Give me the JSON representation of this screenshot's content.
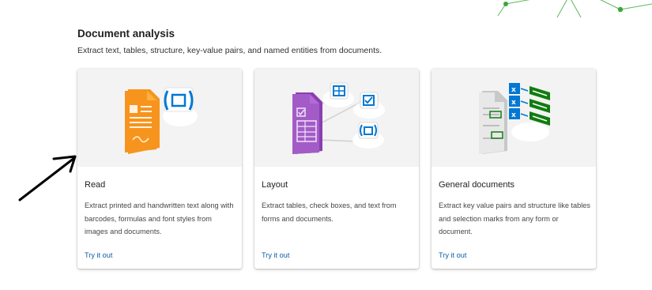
{
  "section": {
    "title": "Document analysis",
    "subtitle": "Extract text, tables, structure, key-value pairs, and named entities from documents."
  },
  "cards": [
    {
      "title": "Read",
      "description": "Extract printed and handwritten text along with barcodes, formulas and font styles from images and documents.",
      "link": "Try it out",
      "icon": "read-document-icon"
    },
    {
      "title": "Layout",
      "description": "Extract tables, check boxes, and text from forms and documents.",
      "link": "Try it out",
      "icon": "layout-document-icon"
    },
    {
      "title": "General documents",
      "description": "Extract key value pairs and structure like tables and selection marks from any form or document.",
      "link": "Try it out",
      "icon": "general-document-icon"
    }
  ],
  "colors": {
    "link": "#0f5ea8",
    "read_orange": "#f7941d",
    "layout_purple": "#a35cc7",
    "general_green": "#107c10",
    "accent_blue": "#0078d4"
  }
}
